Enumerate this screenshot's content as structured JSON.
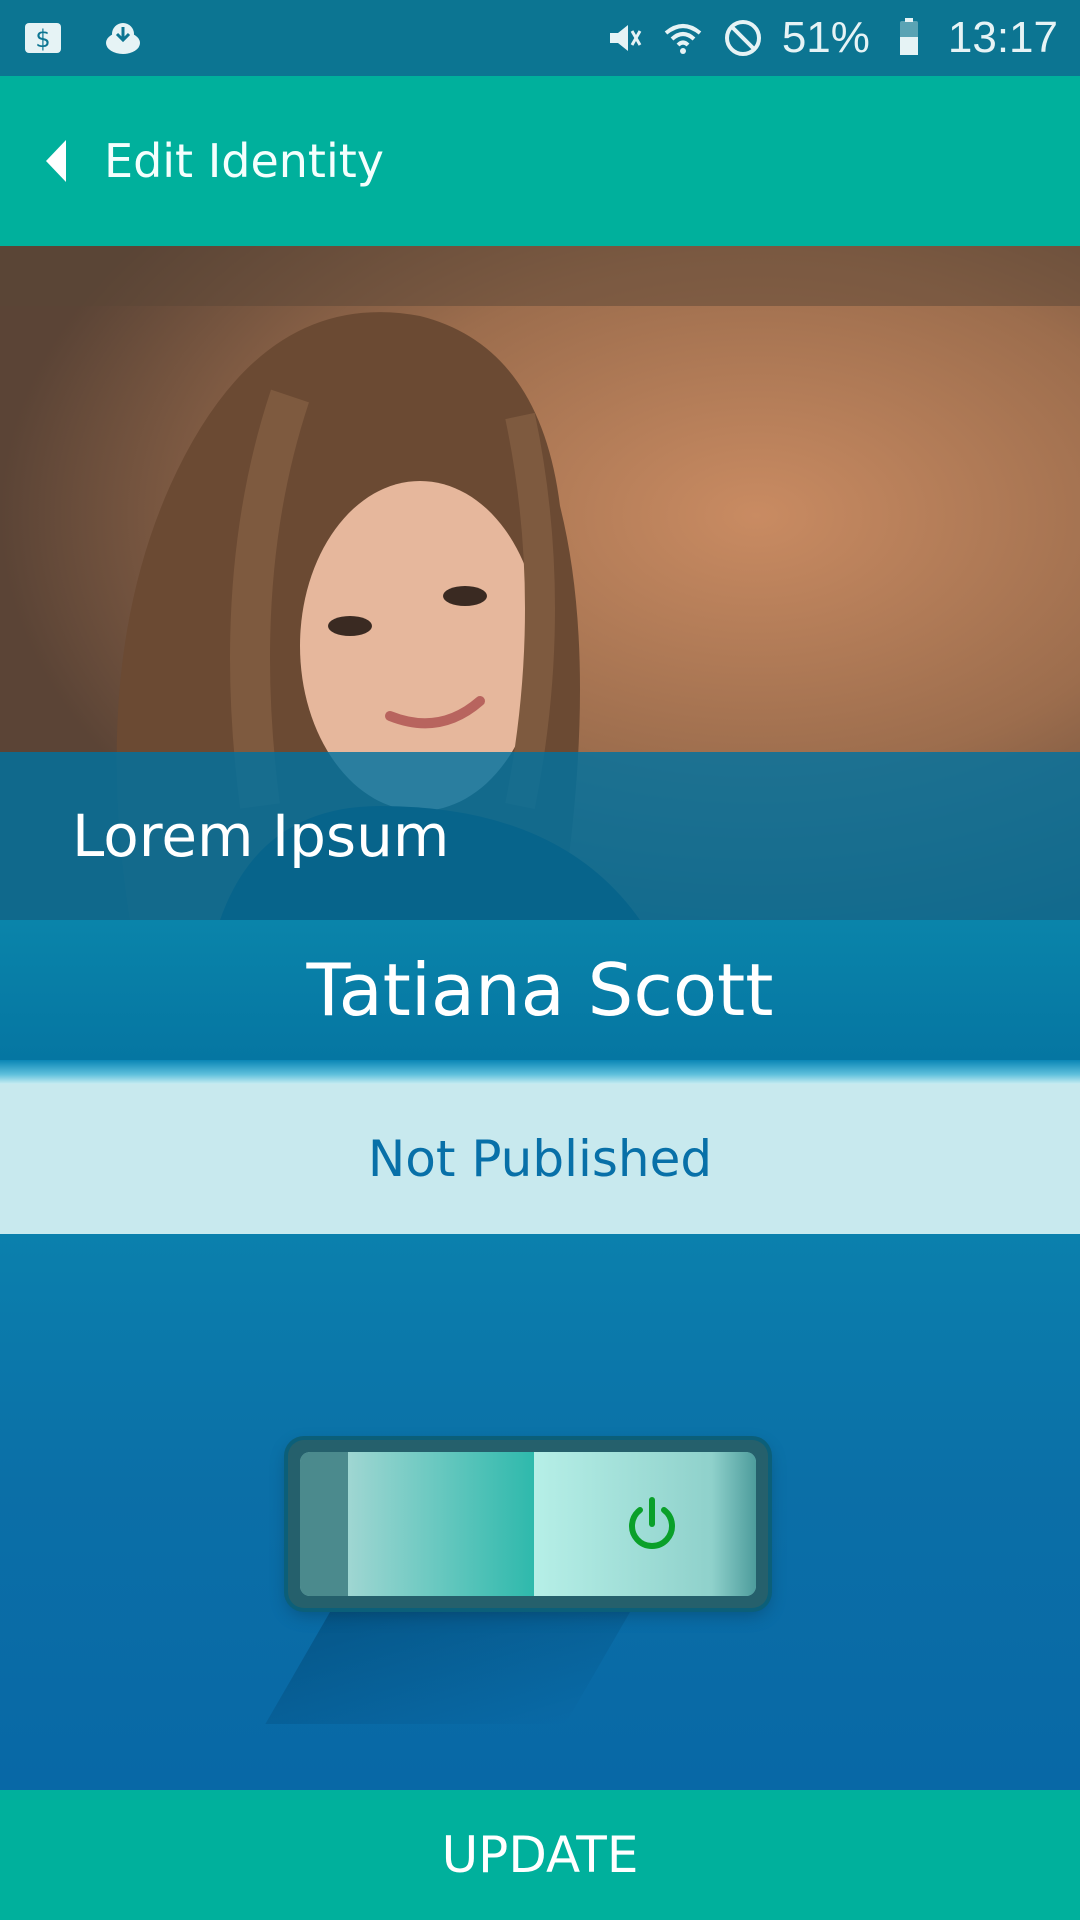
{
  "status_bar": {
    "battery": "51%",
    "time": "13:17",
    "left_icons": [
      "money-icon",
      "download-cloud-icon"
    ],
    "right_icons": [
      "mute-icon",
      "wifi-icon",
      "no-entry-icon",
      "battery-icon"
    ]
  },
  "app_bar": {
    "title": "Edit Identity"
  },
  "profile": {
    "caption": "Lorem Ipsum",
    "name": "Tatiana Scott",
    "publish_status": "Not Published"
  },
  "toggle": {
    "state": "off"
  },
  "actions": {
    "update_label": "UPDATE"
  },
  "colors": {
    "accent": "#00b09c",
    "primary": "#0b6fa7",
    "status_text": "#0870a8",
    "status_band": "#c8e9ee"
  }
}
